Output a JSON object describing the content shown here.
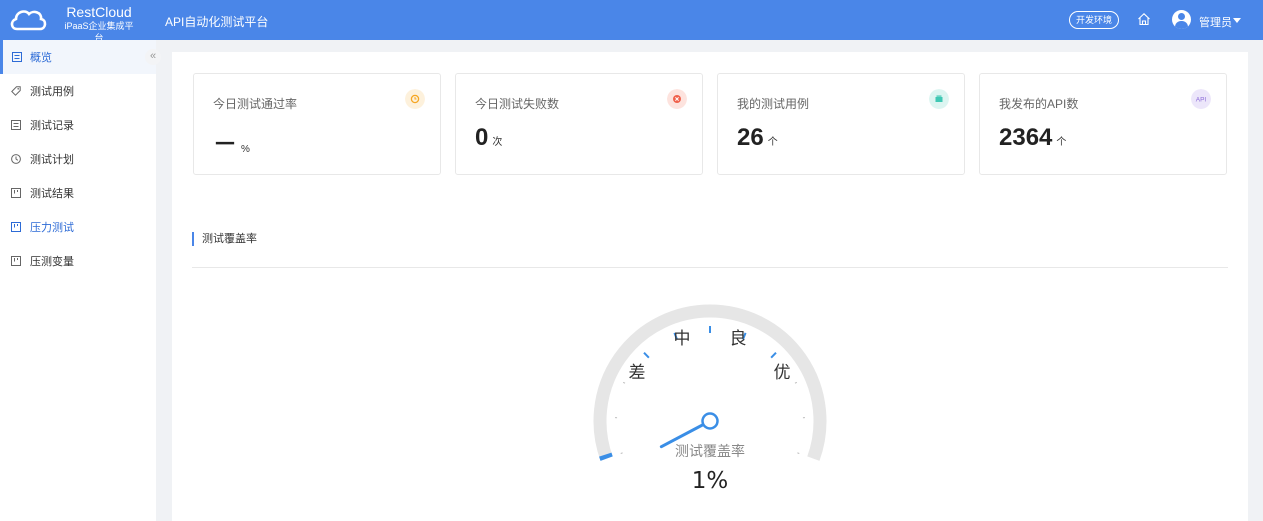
{
  "brand": {
    "name": "RestCloud",
    "sub": "iPaaS企业集成平台"
  },
  "header": {
    "app_title": "API自动化测试平台",
    "env": "开发环境",
    "user": "管理员"
  },
  "sidebar": {
    "collapse_glyph": "«",
    "items": [
      {
        "label": "概览",
        "icon": "overview-icon"
      },
      {
        "label": "测试用例",
        "icon": "tag-icon"
      },
      {
        "label": "测试记录",
        "icon": "record-icon"
      },
      {
        "label": "测试计划",
        "icon": "clock-icon"
      },
      {
        "label": "测试结果",
        "icon": "result-icon"
      },
      {
        "label": "压力测试",
        "icon": "stress-icon"
      },
      {
        "label": "压测变量",
        "icon": "variable-icon"
      }
    ]
  },
  "cards": [
    {
      "label": "今日测试通过率",
      "value": "－",
      "unit": "%",
      "icon": "pass-rate-icon",
      "color": "#f5a623"
    },
    {
      "label": "今日测试失败数",
      "value": "0",
      "unit": "次",
      "icon": "fail-icon",
      "color": "#f0614c"
    },
    {
      "label": "我的测试用例",
      "value": "26",
      "unit": "个",
      "icon": "case-icon",
      "color": "#3fc8b4"
    },
    {
      "label": "我发布的API数",
      "value": "2364",
      "unit": "个",
      "icon": "api-icon",
      "icon_text": "API",
      "color": "#8b6ad8"
    }
  ],
  "coverage": {
    "section_title": "测试覆盖率",
    "gauge_title": "测试覆盖率",
    "value_text": "1%",
    "value": 1,
    "labels": {
      "poor": "差",
      "medium": "中",
      "good": "良",
      "excellent": "优"
    }
  },
  "colors": {
    "accent": "#4a86e8",
    "gauge_track": "#e6e6e6",
    "gauge_value": "#3a8ee6"
  }
}
